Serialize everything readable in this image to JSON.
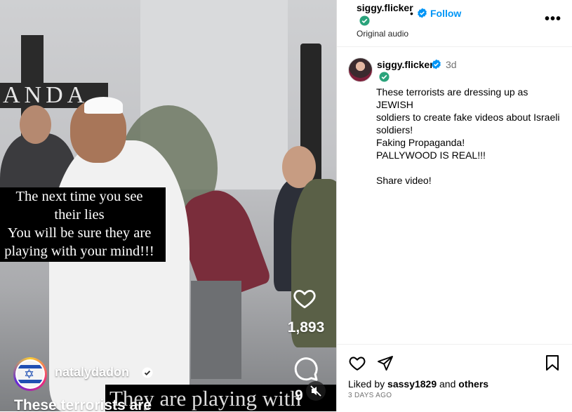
{
  "video": {
    "sign_text": "ANDA",
    "overlay_caption": [
      "The next time you see",
      "their lies",
      "You will be sure they are",
      "playing with your mind!!!"
    ],
    "subtitle_text": "They are playing with",
    "like_count": "1,893",
    "comment_count": "9",
    "author": "natalydadon",
    "caption_preview": "These terrorists are",
    "icons": [
      "heart-icon",
      "comment-icon",
      "mute-icon",
      "verified-icon"
    ]
  },
  "header": {
    "username": "siggy.flicker",
    "separator": "•",
    "follow_label": "Follow",
    "audio_label": "Original audio",
    "more_label": "•••"
  },
  "post": {
    "username": "siggy.flicker",
    "time": "3d",
    "lines": [
      "These terrorists are dressing up as JEWISH",
      "soldiers to create fake videos about Israeli",
      "soldiers!",
      "Faking Propaganda!",
      "PALLYWOOD IS REAL!!!",
      "",
      "Share video!"
    ]
  },
  "footer": {
    "liked_prefix": "Liked by",
    "liked_user": "sassy1829",
    "liked_and": "and",
    "liked_others": "others",
    "ago": "3 DAYS AGO"
  },
  "colors": {
    "verified_blue": "#0095f6",
    "verified_green": "#2aa37b",
    "follow_blue": "#0095f6"
  }
}
